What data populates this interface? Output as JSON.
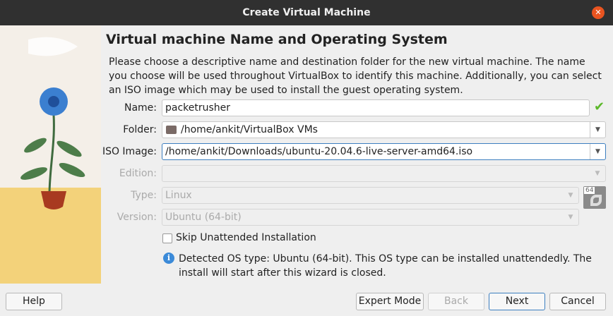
{
  "window": {
    "title": "Create Virtual Machine"
  },
  "heading": "Virtual machine Name and Operating System",
  "description": "Please choose a descriptive name and destination folder for the new virtual machine. The name you choose will be used throughout VirtualBox to identify this machine. Additionally, you can select an ISO image which may be used to install the guest operating system.",
  "form": {
    "name_label": "Name:",
    "name_value": "packetrusher",
    "folder_label": "Folder:",
    "folder_value": "/home/ankit/VirtualBox VMs",
    "iso_label": "ISO Image:",
    "iso_value": "/home/ankit/Downloads/ubuntu-20.04.6-live-server-amd64.iso",
    "edition_label": "Edition:",
    "edition_value": "",
    "type_label": "Type:",
    "type_value": "Linux",
    "version_label": "Version:",
    "version_value": "Ubuntu (64-bit)",
    "os_badge": "64",
    "skip_label": "Skip Unattended Installation",
    "info_text": "Detected OS type: Ubuntu (64-bit). This OS type can be installed unattendedly. The install will start after this wizard is closed."
  },
  "buttons": {
    "help": "Help",
    "expert": "Expert Mode",
    "back": "Back",
    "next": "Next",
    "cancel": "Cancel"
  }
}
